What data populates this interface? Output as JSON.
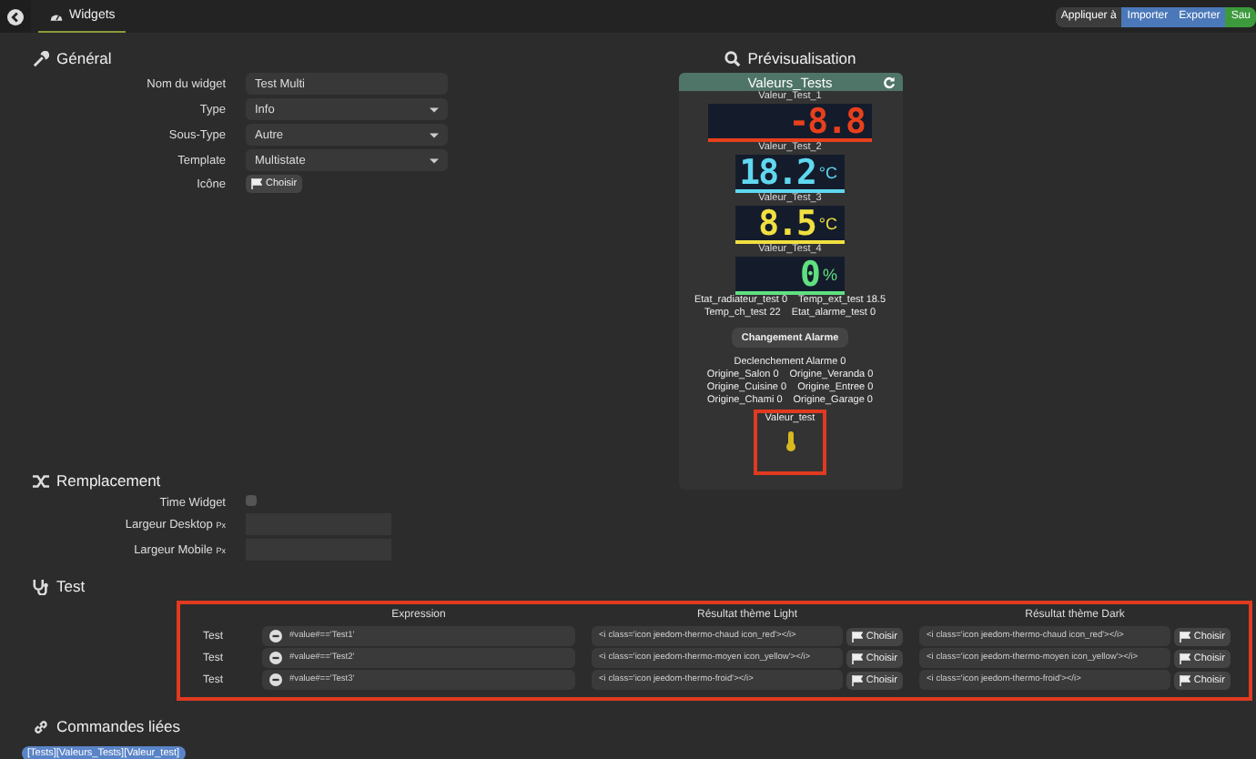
{
  "top_bar": {
    "tab": "Widgets",
    "actions": [
      {
        "label": "Appliquer à",
        "kind": "neutral"
      },
      {
        "label": "Importer",
        "kind": "primary"
      },
      {
        "label": "Exporter",
        "kind": "primary"
      },
      {
        "label": "Sau",
        "kind": "success"
      }
    ]
  },
  "general": {
    "title": "Général",
    "fields": [
      {
        "label": "Nom du widget",
        "kind": "text",
        "value": "Test Multi"
      },
      {
        "label": "Type",
        "kind": "select",
        "value": "Info"
      },
      {
        "label": "Sous-Type",
        "kind": "select",
        "value": "Autre"
      },
      {
        "label": "Template",
        "kind": "select",
        "value": "Multistate"
      },
      {
        "label": "Icône",
        "kind": "button",
        "value": "Choisir"
      }
    ]
  },
  "preview": {
    "title": "Prévisualisation",
    "card_title": "Valeurs_Tests",
    "displays": [
      {
        "name": "Valeur_Test_1",
        "value": "-8.8",
        "color": "#e8401c"
      },
      {
        "name": "Valeur_Test_2",
        "value": "18.2",
        "unit": "°C",
        "color": "#5fd8f0"
      },
      {
        "name": "Valeur_Test_3",
        "value": "8.5",
        "unit": "°C",
        "color": "#f0e040"
      },
      {
        "name": "Valeur_Test_4",
        "value": "0",
        "unit": "%",
        "color": "#60e080"
      }
    ],
    "info_lines_1": [
      [
        "Etat_radiateur_test 0",
        "Temp_ext_test 18.5"
      ],
      [
        "Temp_ch_test 22",
        "Etat_alarme_test 0"
      ]
    ],
    "button": "Changement Alarme",
    "info_lines_2": [
      [
        "Declenchement Alarme 0"
      ],
      [
        "Origine_Salon 0",
        "Origine_Veranda 0"
      ],
      [
        "Origine_Cuisine 0",
        "Origine_Entree 0"
      ],
      [
        "Origine_Chami 0",
        "Origine_Garage 0"
      ]
    ],
    "last_name": "Valeur_test"
  },
  "replacement": {
    "title": "Remplacement",
    "time_widget": {
      "label": "Time Widget",
      "checked": false
    },
    "widths": [
      {
        "label": "Largeur Desktop",
        "unit": "Px"
      },
      {
        "label": "Largeur Mobile",
        "unit": "Px"
      }
    ]
  },
  "test": {
    "title": "Test",
    "columns": [
      "Expression",
      "Résultat thème Light",
      "Résultat thème Dark"
    ],
    "rows": [
      {
        "label": "Test",
        "expression": "#value#=='Test1'",
        "light": "<i class='icon jeedom-thermo-chaud icon_red'></i>",
        "light_button": "Choisir",
        "dark": "<i class='icon jeedom-thermo-chaud icon_red'></i>",
        "dark_button": "Choisir"
      },
      {
        "label": "Test",
        "expression": "#value#=='Test2'",
        "light": "<i class='icon jeedom-thermo-moyen icon_yellow'></i>",
        "light_button": "Choisir",
        "dark": "<i class='icon jeedom-thermo-moyen icon_yellow'></i>",
        "dark_button": "Choisir"
      },
      {
        "label": "Test",
        "expression": "#value#=='Test3'",
        "light": "<i class='icon jeedom-thermo-froid'></i>",
        "light_button": "Choisir",
        "dark": "<i class='icon jeedom-thermo-froid'></i>",
        "dark_button": "Choisir"
      }
    ]
  },
  "linked": {
    "title": "Commandes liées",
    "tag": "[Tests][Valeurs_Tests][Valeur_test]"
  }
}
